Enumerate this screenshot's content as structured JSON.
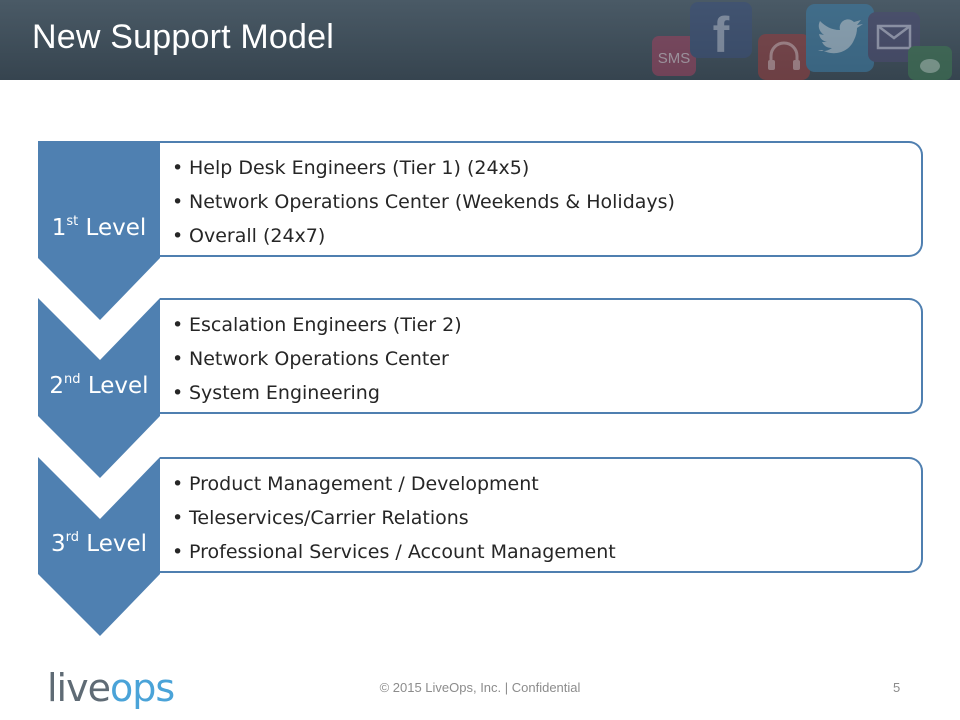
{
  "slide": {
    "title": "New Support Model"
  },
  "header_icons": [
    {
      "name": "sms-icon",
      "text": "SMS"
    },
    {
      "name": "facebook-icon",
      "text": "f"
    },
    {
      "name": "headset-icon"
    },
    {
      "name": "twitter-icon"
    },
    {
      "name": "email-icon"
    },
    {
      "name": "chat-icon"
    }
  ],
  "levels": [
    {
      "number": "1",
      "suffix": "st",
      "word": "Level",
      "items": [
        "Help Desk Engineers (Tier 1) (24x5)",
        "Network Operations Center (Weekends & Holidays)",
        "Overall (24x7)"
      ]
    },
    {
      "number": "2",
      "suffix": "nd",
      "word": "Level",
      "items": [
        "Escalation Engineers (Tier 2)",
        "Network Operations Center",
        "System Engineering"
      ]
    },
    {
      "number": "3",
      "suffix": "rd",
      "word": "Level",
      "items": [
        "Product Management / Development",
        "Teleservices/Carrier Relations",
        "Professional Services / Account Management"
      ]
    }
  ],
  "footer": {
    "logo_part1": "live",
    "logo_part2": "ops",
    "copyright": "© 2015 LiveOps, Inc. | Confidential",
    "page_number": "5"
  },
  "colors": {
    "chevron": "#4f80b1",
    "box_border": "#4f7fb0",
    "header": "#3f4e59"
  }
}
